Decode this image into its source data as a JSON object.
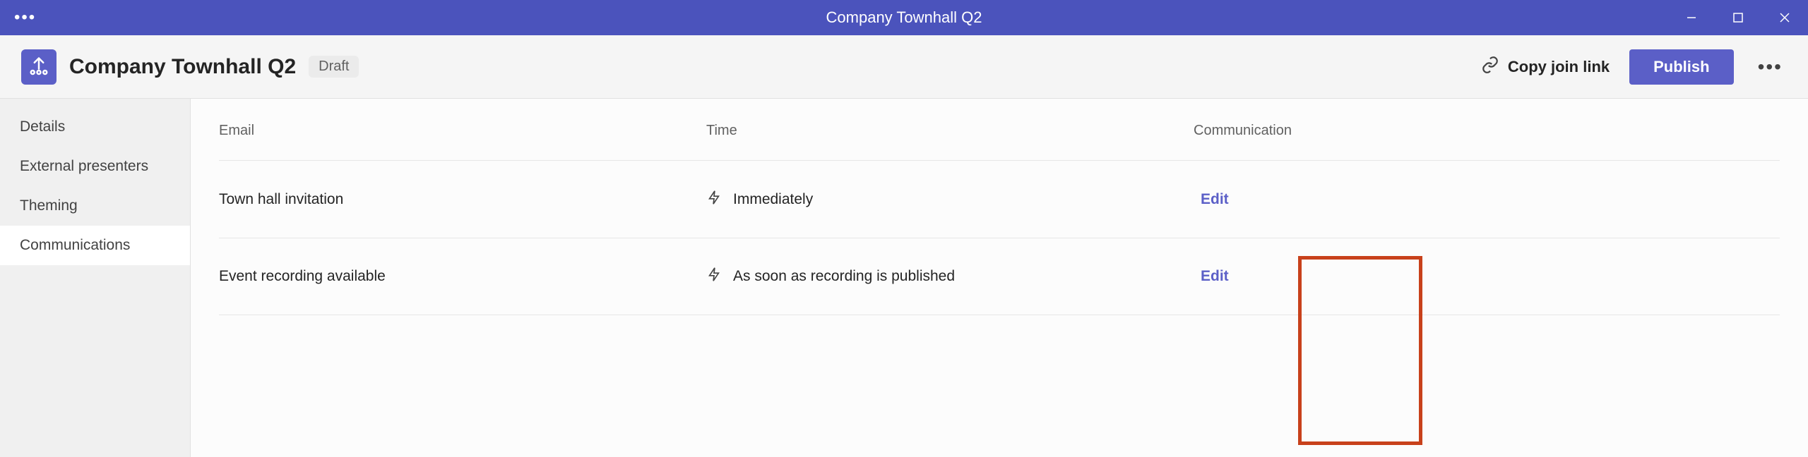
{
  "titlebar": {
    "window_title": "Company Townhall Q2"
  },
  "header": {
    "event_title": "Company Townhall Q2",
    "status_badge": "Draft",
    "copy_link_label": "Copy join link",
    "publish_label": "Publish"
  },
  "sidebar": {
    "items": [
      {
        "label": "Details",
        "active": false
      },
      {
        "label": "External presenters",
        "active": false
      },
      {
        "label": "Theming",
        "active": false
      },
      {
        "label": "Communications",
        "active": true
      }
    ]
  },
  "table": {
    "headers": {
      "email": "Email",
      "time": "Time",
      "communication": "Communication"
    },
    "rows": [
      {
        "email": "Town hall invitation",
        "time": "Immediately",
        "action": "Edit"
      },
      {
        "email": "Event recording available",
        "time": "As soon as recording is published",
        "action": "Edit"
      }
    ]
  }
}
